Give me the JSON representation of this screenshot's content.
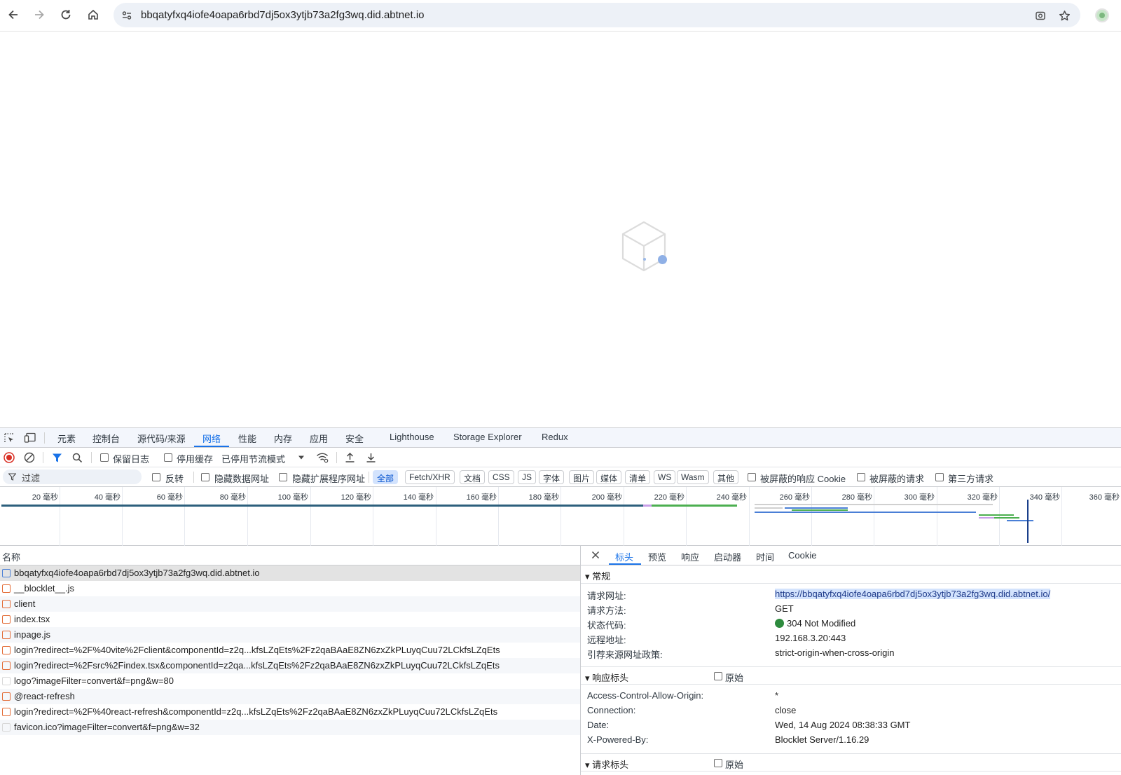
{
  "browser": {
    "url": "bbqatyfxq4iofe4oapa6rbd7dj5ox3ytjb73a2fg3wq.did.abtnet.io"
  },
  "devtools": {
    "tabs": [
      "元素",
      "控制台",
      "源代码/来源",
      "网络",
      "性能",
      "内存",
      "应用",
      "安全",
      "Lighthouse",
      "Storage Explorer",
      "Redux"
    ],
    "active_tab": "网络",
    "toolbar": {
      "preserve_log": "保留日志",
      "disable_cache": "停用缓存",
      "throttling": "已停用节流模式"
    },
    "filter_bar": {
      "filter_placeholder": "过滤",
      "invert": "反转",
      "hide_data_urls": "隐藏数据网址",
      "hide_extension_urls": "隐藏扩展程序网址",
      "types": [
        "全部",
        "Fetch/XHR",
        "文档",
        "CSS",
        "JS",
        "字体",
        "图片",
        "媒体",
        "清单",
        "WS",
        "Wasm",
        "其他"
      ],
      "active_type": "全部",
      "blocked_cookies": "被屏蔽的响应 Cookie",
      "blocked_requests": "被屏蔽的请求",
      "third_party": "第三方请求"
    },
    "overview_ticks": [
      "20 毫秒",
      "40 毫秒",
      "60 毫秒",
      "80 毫秒",
      "100 毫秒",
      "120 毫秒",
      "140 毫秒",
      "160 毫秒",
      "180 毫秒",
      "200 毫秒",
      "220 毫秒",
      "240 毫秒",
      "260 毫秒",
      "280 毫秒",
      "300 毫秒",
      "320 毫秒",
      "340 毫秒",
      "360 毫秒"
    ],
    "requests_header": "名称",
    "requests": [
      {
        "name": "bbqatyfxq4iofe4oapa6rbd7dj5ox3ytjb73a2fg3wq.did.abtnet.io",
        "kind": "document"
      },
      {
        "name": "__blocklet__.js",
        "kind": "script"
      },
      {
        "name": "client",
        "kind": "script"
      },
      {
        "name": "index.tsx",
        "kind": "script"
      },
      {
        "name": "inpage.js",
        "kind": "script"
      },
      {
        "name": "login?redirect=%2F%40vite%2Fclient&componentId=z2q...kfsLZqEts%2Fz2qaBAaE8ZN6zxZkPLuyqCuu72LCkfsLZqEts",
        "kind": "script"
      },
      {
        "name": "login?redirect=%2Fsrc%2Findex.tsx&componentId=z2qa...kfsLZqEts%2Fz2qaBAaE8ZN6zxZkPLuyqCuu72LCkfsLZqEts",
        "kind": "script"
      },
      {
        "name": "logo?imageFilter=convert&f=png&w=80",
        "kind": "image"
      },
      {
        "name": "@react-refresh",
        "kind": "script"
      },
      {
        "name": "login?redirect=%2F%40react-refresh&componentId=z2q...kfsLZqEts%2Fz2qaBAaE8ZN6zxZkPLuyqCuu72LCkfsLZqEts",
        "kind": "script"
      },
      {
        "name": "favicon.ico?imageFilter=convert&f=png&w=32",
        "kind": "image"
      }
    ],
    "detail": {
      "tabs": [
        "标头",
        "预览",
        "响应",
        "启动器",
        "时间",
        "Cookie"
      ],
      "active_tab": "标头",
      "general": {
        "title": "常规",
        "rows": [
          {
            "k": "请求网址:",
            "v": "https://bbqatyfxq4iofe4oapa6rbd7dj5ox3ytjb73a2fg3wq.did.abtnet.io/"
          },
          {
            "k": "请求方法:",
            "v": "GET"
          },
          {
            "k": "状态代码:",
            "v": "304 Not Modified"
          },
          {
            "k": "远程地址:",
            "v": "192.168.3.20:443"
          },
          {
            "k": "引荐来源网址政策:",
            "v": "strict-origin-when-cross-origin"
          }
        ]
      },
      "response_headers": {
        "title": "响应标头",
        "raw_label": "原始",
        "rows": [
          {
            "k": "Access-Control-Allow-Origin:",
            "v": "*"
          },
          {
            "k": "Connection:",
            "v": "close"
          },
          {
            "k": "Date:",
            "v": "Wed, 14 Aug 2024 08:38:33 GMT"
          },
          {
            "k": "X-Powered-By:",
            "v": "Blocklet Server/1.16.29"
          }
        ]
      },
      "request_headers": {
        "title": "请求标头",
        "raw_label": "原始"
      }
    }
  },
  "colors": {
    "accent": "#1a73e8",
    "status_ok": "#2e8b3e",
    "record_red": "#d93025"
  }
}
